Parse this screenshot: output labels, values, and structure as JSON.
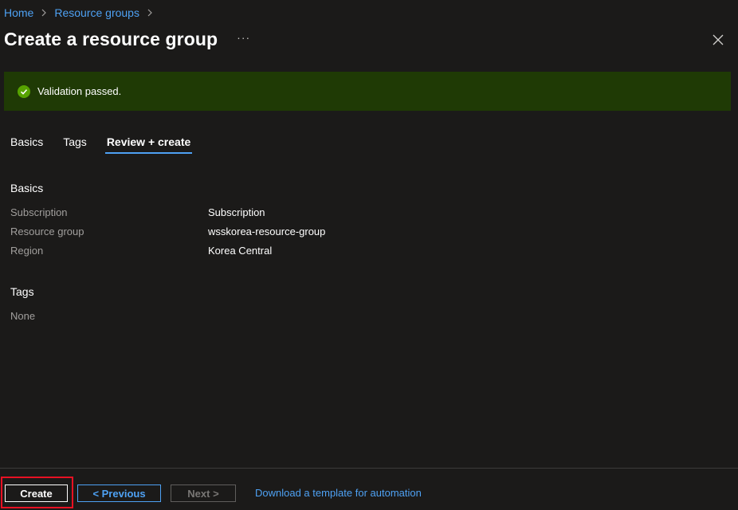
{
  "breadcrumb": {
    "home": "Home",
    "resource_groups": "Resource groups"
  },
  "header": {
    "title": "Create a resource group",
    "more": "···"
  },
  "banner": {
    "message": "Validation passed.",
    "color": "#1f3a05",
    "icon": "check-circle-icon"
  },
  "tabs": [
    {
      "label": "Basics",
      "active": false
    },
    {
      "label": "Tags",
      "active": false
    },
    {
      "label": "Review + create",
      "active": true
    }
  ],
  "basics": {
    "title": "Basics",
    "rows": [
      {
        "key": "Subscription",
        "value": "Subscription"
      },
      {
        "key": "Resource group",
        "value": "wsskorea-resource-group"
      },
      {
        "key": "Region",
        "value": "Korea Central"
      }
    ]
  },
  "tags": {
    "title": "Tags",
    "none": "None"
  },
  "footer": {
    "create": "Create",
    "previous": "< Previous",
    "next": "Next >",
    "download": "Download a template for automation"
  },
  "colors": {
    "accent": "#4ea1f3",
    "highlight": "#e81123",
    "success": "#57a300"
  }
}
